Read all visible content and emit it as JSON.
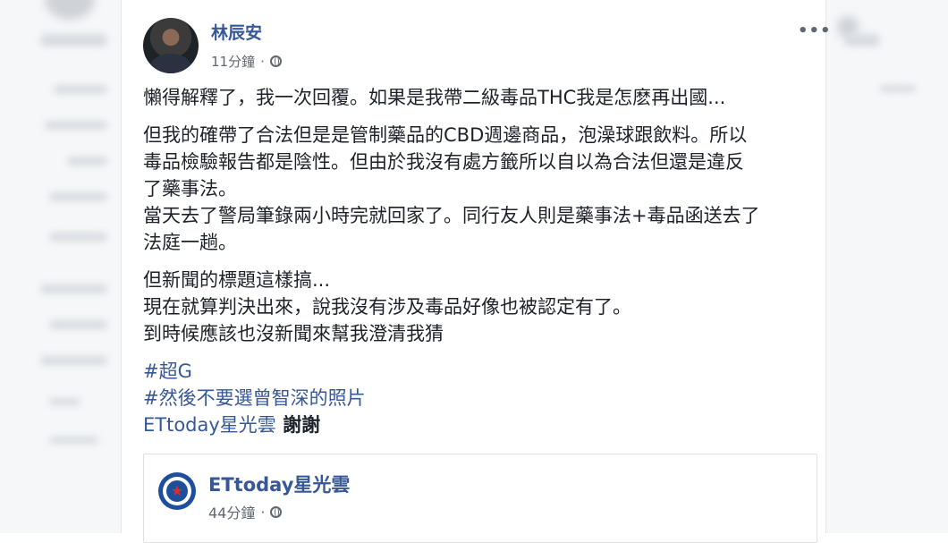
{
  "post": {
    "author": "林辰安",
    "time": "11分鐘",
    "separator": "·",
    "paragraphs": [
      [
        "懶得解釋了，我一次回覆。如果是我帶二級毒品THC我是怎麽再出國..."
      ],
      [
        "但我的確帶了合法但是是管制藥品的CBD週邊商品，泡澡球跟飲料。所以",
        "毒品檢驗報告都是陰性。但由於我沒有處方籤所以自以為合法但還是違反",
        "了藥事法。",
        "當天去了警局筆錄兩小時完就回家了。同行友人則是藥事法+毒品函送去了",
        "法庭一趟。"
      ],
      [
        "但新聞的標題這樣搞...",
        "現在就算判決出來，說我沒有涉及毒品好像也被認定有了。",
        "到時候應該也沒新聞來幫我澄清我猜"
      ]
    ],
    "hashtags": [
      "#超G",
      "#然後不要選曾智深的照片"
    ],
    "mention_page": "ETtoday星光雲",
    "mention_suffix": " 謝謝"
  },
  "shared_post": {
    "page_name": "ETtoday星光雲",
    "time": "44分鐘",
    "separator": "·"
  },
  "icons": {
    "more": "more-options-icon",
    "privacy": "globe-icon",
    "logo": "ettoday-star-logo"
  },
  "colors": {
    "link": "#365899",
    "text": "#1d2129",
    "meta": "#606770"
  }
}
